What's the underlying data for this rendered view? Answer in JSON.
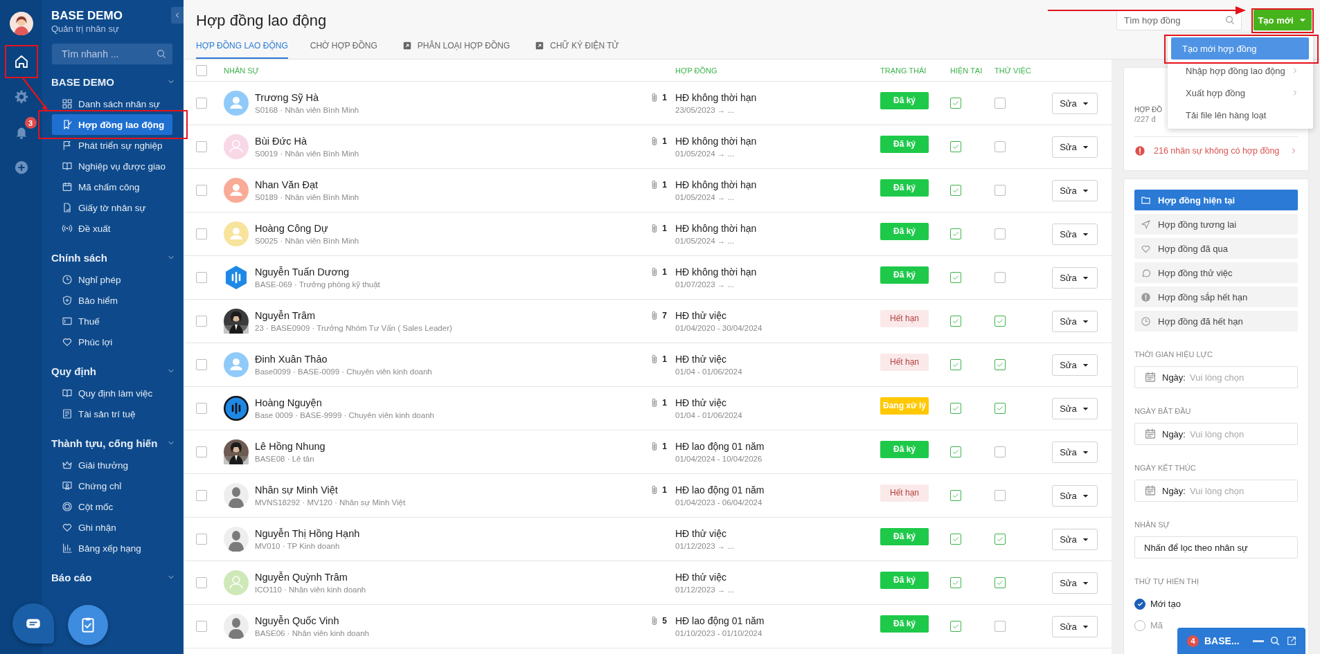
{
  "rail": {
    "notification_count": "3"
  },
  "sidebar": {
    "title": "BASE DEMO",
    "subtitle": "Quản trị nhân sự",
    "search_placeholder": "Tìm nhanh ...",
    "sections": [
      {
        "title": "BASE DEMO",
        "expanded": true,
        "items": [
          {
            "label": "Danh sách nhân sự",
            "selected": false
          },
          {
            "label": "Hợp đồng lao động",
            "selected": true
          },
          {
            "label": "Phát triển sự nghiệp",
            "selected": false
          },
          {
            "label": "Nghiệp vụ được giao",
            "selected": false
          },
          {
            "label": "Mã chấm công",
            "selected": false
          },
          {
            "label": "Giấy tờ nhân sự",
            "selected": false
          },
          {
            "label": "Đề xuất",
            "selected": false
          }
        ]
      },
      {
        "title": "Chính sách",
        "expanded": true,
        "items": [
          {
            "label": "Nghỉ phép",
            "selected": false
          },
          {
            "label": "Bảo hiểm",
            "selected": false
          },
          {
            "label": "Thuế",
            "selected": false
          },
          {
            "label": "Phúc lợi",
            "selected": false
          }
        ]
      },
      {
        "title": "Quy định",
        "expanded": true,
        "items": [
          {
            "label": "Quy định làm việc",
            "selected": false
          },
          {
            "label": "Tài sản trí tuệ",
            "selected": false
          }
        ]
      },
      {
        "title": "Thành tựu, cống hiến",
        "expanded": true,
        "items": [
          {
            "label": "Giải thưởng",
            "selected": false
          },
          {
            "label": "Chứng chỉ",
            "selected": false
          },
          {
            "label": "Cột mốc",
            "selected": false
          },
          {
            "label": "Ghi nhận",
            "selected": false
          },
          {
            "label": "Bảng xếp hạng",
            "selected": false
          }
        ]
      },
      {
        "title": "Báo cáo",
        "expanded": true
      }
    ]
  },
  "page_title": "Hợp đồng lao động",
  "tabs": [
    {
      "label": "HỢP ĐỒNG LAO ĐỘNG",
      "selected": true,
      "external": false
    },
    {
      "label": "CHỜ HỢP ĐỒNG",
      "selected": false,
      "external": false
    },
    {
      "label": "PHÂN LOẠI HỢP ĐỒNG",
      "selected": false,
      "external": true
    },
    {
      "label": "CHỮ KÝ ĐIỆN TỬ",
      "selected": false,
      "external": true
    }
  ],
  "search": {
    "placeholder": "Tìm hợp đồng"
  },
  "create_button": "Tạo mới",
  "create_menu": [
    {
      "label": "Tạo mới hợp đồng",
      "selected": true,
      "submenu": false
    },
    {
      "label": "Nhập hợp đồng lao động",
      "selected": false,
      "submenu": true
    },
    {
      "label": "Xuất hợp đồng",
      "selected": false,
      "submenu": true
    },
    {
      "label": "Tải file lên hàng loạt",
      "selected": false,
      "submenu": false
    }
  ],
  "table": {
    "select_all_checked": false,
    "columns": [
      "NHÂN SỰ",
      "HỢP ĐỒNG",
      "TRẠNG THÁI",
      "HIỆN TẠI",
      "THỬ VIỆC"
    ],
    "rows": [
      {
        "selected": false,
        "avatar": {
          "kind": "person",
          "color": "#90caf9"
        },
        "name": "Trương Sỹ Hà",
        "info": "S0168 · Nhân viên Bình Minh",
        "attachments": "1",
        "contract": "HĐ không thời hạn",
        "period": "23/05/2023 → ...",
        "status": {
          "kind": "signed",
          "text": "Đã ký"
        },
        "current": true,
        "probation": false,
        "action": "Sửa"
      },
      {
        "selected": false,
        "avatar": {
          "kind": "outline",
          "color": "#f8d7e6"
        },
        "name": "Bùi Đức Hà",
        "info": "S0019 · Nhân viên Bình Minh",
        "attachments": "1",
        "contract": "HĐ không thời hạn",
        "period": "01/05/2024 → ...",
        "status": {
          "kind": "signed",
          "text": "Đã ký"
        },
        "current": true,
        "probation": false,
        "action": "Sửa"
      },
      {
        "selected": false,
        "avatar": {
          "kind": "person",
          "color": "#f9ab97"
        },
        "name": "Nhan Văn Đạt",
        "info": "S0189 · Nhân viên Bình Minh",
        "attachments": "1",
        "contract": "HĐ không thời hạn",
        "period": "01/05/2024 → ...",
        "status": {
          "kind": "signed",
          "text": "Đã ký"
        },
        "current": true,
        "probation": false,
        "action": "Sửa"
      },
      {
        "selected": false,
        "avatar": {
          "kind": "person",
          "color": "#f7e39c"
        },
        "name": "Hoàng Công Dự",
        "info": "S0025 · Nhân viên Bình Minh",
        "attachments": "1",
        "contract": "HĐ không thời hạn",
        "period": "01/05/2024 → ...",
        "status": {
          "kind": "signed",
          "text": "Đã ký"
        },
        "current": true,
        "probation": false,
        "action": "Sửa"
      },
      {
        "selected": false,
        "avatar": {
          "kind": "hexagon",
          "color": "#1e88e5"
        },
        "name": "Nguyễn Tuấn Dương",
        "info": "BASE-069 · Trưởng phòng kỹ thuật",
        "attachments": "1",
        "contract": "HĐ không thời hạn",
        "period": "01/07/2023 → ...",
        "status": {
          "kind": "signed",
          "text": "Đã ký"
        },
        "current": true,
        "probation": false,
        "action": "Sửa"
      },
      {
        "selected": false,
        "name": "Nguyễn Trâm",
        "info": "23 · BASE0909 · Trưởng Nhóm Tư Vấn ( Sales Leader)",
        "attachments": "7",
        "contract": "HĐ thử việc",
        "period": "01/04/2020 - 30/04/2024",
        "status": {
          "kind": "expired",
          "text": "Hết hạn"
        },
        "current": true,
        "probation": true,
        "action": "Sửa"
      },
      {
        "selected": false,
        "avatar": {
          "kind": "person",
          "color": "#90caf9"
        },
        "name": "Đinh Xuân Thảo",
        "info": "Base0099 · BASE-0099 · Chuyên viên kinh doanh",
        "attachments": "1",
        "contract": "HĐ thử việc",
        "period": "01/04 - 01/06/2024",
        "status": {
          "kind": "expired",
          "text": "Hết hạn"
        },
        "current": true,
        "probation": true,
        "action": "Sửa"
      },
      {
        "selected": false,
        "avatar": {
          "kind": "round",
          "color": "#1e88e5"
        },
        "name": "Hoàng Nguyện",
        "info": "Base 0009 · BASE-9999 · Chuyên viên kinh doanh",
        "attachments": "1",
        "contract": "HĐ thử việc",
        "period": "01/04 - 01/06/2024",
        "status": {
          "kind": "processing",
          "text": "Đang xử lý"
        },
        "current": true,
        "probation": true,
        "action": "Sửa"
      },
      {
        "selected": false,
        "name": "Lê Hồng Nhung",
        "info": "BASE08 · Lê tân",
        "attachments": "1",
        "contract": "HĐ lao động 01 năm",
        "period": "01/04/2024 - 10/04/2026",
        "status": {
          "kind": "signed",
          "text": "Đã ký"
        },
        "current": true,
        "probation": false,
        "action": "Sửa"
      },
      {
        "selected": false,
        "avatar": {
          "kind": "silhouette",
          "color": "#eeeeee"
        },
        "name": "Nhân sự Minh Việt",
        "info": "MVNS18292 · MV120 · Nhân sự Minh Việt",
        "attachments": "1",
        "contract": "HĐ lao động 01 năm",
        "period": "01/04/2023 - 06/04/2024",
        "status": {
          "kind": "expired",
          "text": "Hết hạn"
        },
        "current": true,
        "probation": false,
        "action": "Sửa"
      },
      {
        "selected": false,
        "avatar": {
          "kind": "silhouette",
          "color": "#eeeeee"
        },
        "name": "Nguyễn Thị Hồng Hạnh",
        "info": "MV010 · TP Kinh doanh",
        "contract": "HĐ thử việc",
        "period": "01/12/2023 → ...",
        "status": {
          "kind": "signed",
          "text": "Đã ký"
        },
        "current": true,
        "probation": true,
        "action": "Sửa"
      },
      {
        "selected": false,
        "avatar": {
          "kind": "outline",
          "color": "#cfe8b8"
        },
        "name": "Nguyễn Quỳnh Trâm",
        "info": "ICO110 · Nhân viên kinh doanh",
        "contract": "HĐ thử việc",
        "period": "01/12/2023 → ...",
        "status": {
          "kind": "signed",
          "text": "Đã ký"
        },
        "current": true,
        "probation": true,
        "action": "Sửa"
      },
      {
        "selected": false,
        "avatar": {
          "kind": "silhouette",
          "color": "#eeeeee"
        },
        "name": "Nguyễn Quốc Vinh",
        "info": "BASE06 · Nhân viên kinh doanh",
        "attachments": "5",
        "contract": "HĐ lao động 01 năm",
        "period": "01/10/2023 - 01/10/2024",
        "status": {
          "kind": "signed",
          "text": "Đã ký"
        },
        "current": true,
        "probation": false,
        "action": "Sửa"
      }
    ]
  },
  "summary": {
    "label": "HỢP ĐỒ",
    "count": "/227 đ",
    "warning": "216 nhân sự không có hợp đồng"
  },
  "filters": [
    {
      "label": "Hợp đồng hiện tại",
      "selected": true
    },
    {
      "label": "Hợp đồng tương lai",
      "selected": false
    },
    {
      "label": "Hợp đồng đã qua",
      "selected": false
    },
    {
      "label": "Hợp đồng thử việc",
      "selected": false
    },
    {
      "label": "Hợp đồng sắp hết hạn",
      "selected": false
    },
    {
      "label": "Hợp đồng đã hết hạn",
      "selected": false
    }
  ],
  "date_filters": [
    {
      "label": "THỜI GIAN HIỆU LỰC",
      "prefix": "Ngày:",
      "placeholder": "Vui lòng chọn"
    },
    {
      "label": "NGÀY BẮT ĐẦU",
      "prefix": "Ngày:",
      "placeholder": "Vui lòng chọn"
    },
    {
      "label": "NGÀY KẾT THÚC",
      "prefix": "Ngày:",
      "placeholder": "Vui lòng chọn"
    }
  ],
  "staff_filter": {
    "label": "NHÂN SỰ",
    "placeholder": "Nhấn để lọc theo nhân sự"
  },
  "sort": {
    "label": "THỨ TỰ HIỂN THỊ",
    "options": [
      {
        "label": "Mới tạo",
        "selected": true
      },
      {
        "label": "Mã",
        "selected": false
      }
    ]
  },
  "chat_bar": {
    "count": "4",
    "title": "BASE..."
  }
}
